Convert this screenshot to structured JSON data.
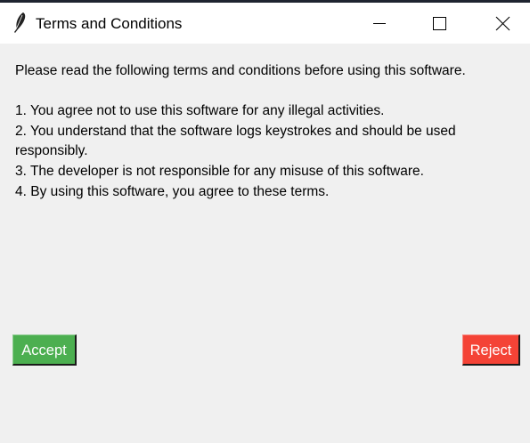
{
  "window": {
    "title": "Terms and Conditions",
    "icon": "feather-icon",
    "controls": {
      "minimize_icon": "minimize-icon",
      "maximize_icon": "maximize-icon",
      "close_icon": "close-icon"
    }
  },
  "content": {
    "intro": "Please read the following terms and conditions before using this software.",
    "terms": [
      "1. You agree not to use this software for any illegal activities.",
      "2. You understand that the software logs keystrokes and should be used responsibly.",
      "3. The developer is not responsible for any misuse of this software.",
      "4. By using this software, you agree to these terms."
    ]
  },
  "buttons": {
    "accept_label": "Accept",
    "reject_label": "Reject"
  },
  "colors": {
    "accept": "#4caf50",
    "reject": "#f44336",
    "background": "#f0f0f0",
    "titlebar": "#ffffff"
  }
}
